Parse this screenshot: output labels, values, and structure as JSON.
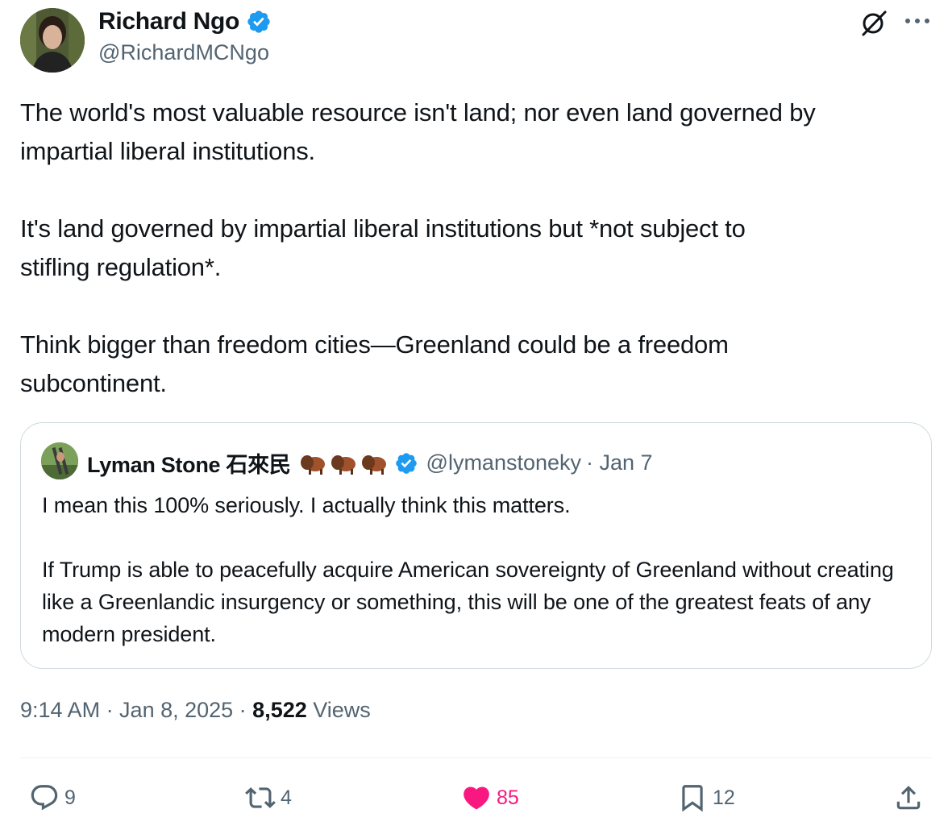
{
  "author": {
    "name": "Richard Ngo",
    "handle": "@RichardMCNgo",
    "verified": true
  },
  "tweet": {
    "paragraphs": [
      "The world's most valuable resource isn't land; nor even land governed by\nimpartial liberal institutions.",
      "It's land governed by impartial liberal institutions but *not subject to\nstifling regulation*.",
      "Think bigger than freedom cities—Greenland could be a freedom\nsubcontinent."
    ]
  },
  "quote": {
    "name": "Lyman Stone 石來民",
    "emoji": [
      "bison",
      "bison",
      "bison"
    ],
    "verified": true,
    "handle": "@lymanstoneky",
    "date": "· Jan 7",
    "paragraphs": [
      "I mean this 100% seriously. I actually think this matters.",
      "If Trump is able to peacefully acquire American sovereignty of Greenland without creating like a Greenlandic insurgency or something, this will be one of the greatest feats of any modern president."
    ]
  },
  "meta": {
    "time_date": "9:14 AM · Jan 8, 2025 · ",
    "views_count": "8,522",
    "views_label": "Views"
  },
  "actions": {
    "replies": "9",
    "reposts": "4",
    "likes": "85",
    "bookmarks": "12"
  },
  "icons": {
    "top_right": [
      "grok-icon",
      "more-icon"
    ],
    "actions": [
      "reply-icon",
      "repost-icon",
      "heart-icon",
      "bookmark-icon",
      "share-icon"
    ]
  },
  "colors": {
    "like": "#f91880",
    "verified": "#1d9bf0",
    "secondary_text": "#536471"
  }
}
